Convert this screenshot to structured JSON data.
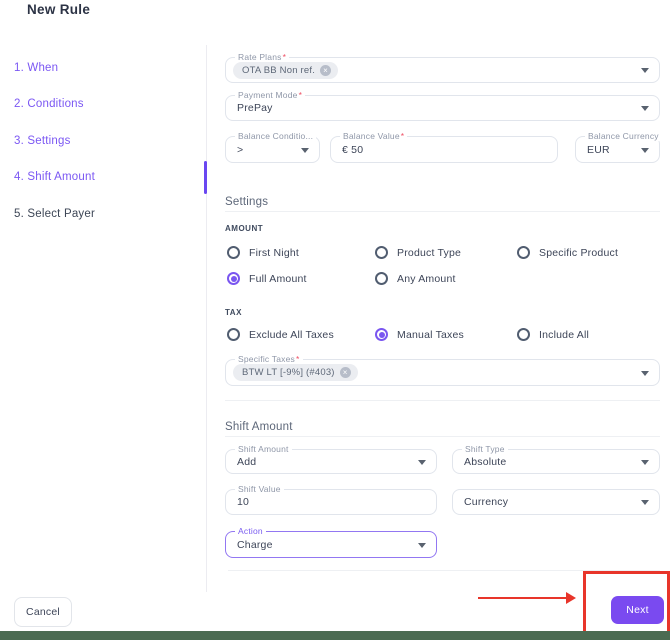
{
  "title": "New Rule",
  "misc": {
    "required_mark": "*"
  },
  "icons": {
    "chip_remove": "×"
  },
  "stepper": {
    "items": [
      {
        "label": "1. When"
      },
      {
        "label": "2. Conditions"
      },
      {
        "label": "3. Settings"
      },
      {
        "label": "4. Shift Amount"
      },
      {
        "label": "5. Select Payer"
      }
    ],
    "active_label": "4. Shift Amount"
  },
  "conditions": {
    "rate_plans_label": "Rate Plans",
    "rate_plans_chip": "OTA BB Non ref.",
    "payment_mode_label": "Payment Mode",
    "payment_mode_value": "PrePay",
    "balance_condition_label": "Balance Conditio...",
    "balance_condition_value": ">",
    "balance_value_label": "Balance Value",
    "balance_value_value": "€ 50",
    "balance_currency_label": "Balance Currency",
    "balance_currency_value": "EUR"
  },
  "settings": {
    "heading": "Settings",
    "amount_group_label": "AMOUNT",
    "amount_options": [
      {
        "label": "First Night",
        "selected": false
      },
      {
        "label": "Product Type",
        "selected": false
      },
      {
        "label": "Specific Product",
        "selected": false
      },
      {
        "label": "Full Amount",
        "selected": true
      },
      {
        "label": "Any Amount",
        "selected": false
      }
    ],
    "tax_group_label": "TAX",
    "tax_options": [
      {
        "label": "Exclude All Taxes",
        "selected": false
      },
      {
        "label": "Manual Taxes",
        "selected": true
      },
      {
        "label": "Include All",
        "selected": false
      }
    ],
    "specific_taxes_label": "Specific Taxes",
    "specific_taxes_chip": "BTW LT [-9%] (#403)"
  },
  "shift": {
    "heading": "Shift Amount",
    "shift_amount_label": "Shift Amount",
    "shift_amount_value": "Add",
    "shift_type_label": "Shift Type",
    "shift_type_value": "Absolute",
    "shift_value_label": "Shift Value",
    "shift_value_value": "10",
    "currency_value": "Currency",
    "action_label": "Action",
    "action_value": "Charge"
  },
  "footer": {
    "cancel_label": "Cancel",
    "next_label": "Next"
  },
  "colors": {
    "accent_purple": "#7a4af0",
    "annotation_red": "#e8352a",
    "bottom_bar_green": "#4b6b52"
  }
}
